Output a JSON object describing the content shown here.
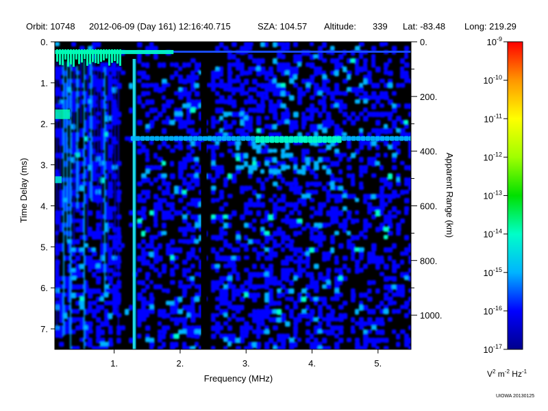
{
  "header": {
    "orbit": "Orbit: 10748",
    "date": "2012-06-09 (Day 161) 12:16:40.715",
    "sza": "SZA: 104.57",
    "altitude_label": "Altitude:",
    "altitude_value": "339",
    "lat": "Lat: -83.48",
    "long": "Long: 219.29"
  },
  "chart_data": {
    "type": "heatmap",
    "xlabel": "Frequency (MHz)",
    "ylabel": "Time Delay (ms)",
    "y2label": "Apparent Range (km)",
    "xlim": [
      0.1,
      5.5
    ],
    "ylim": [
      0,
      7.5
    ],
    "y_inverted": true,
    "x_ticks": [
      1,
      2,
      3,
      4,
      5
    ],
    "x_tick_labels": [
      "1.",
      "2.",
      "3.",
      "4.",
      "5."
    ],
    "y_ticks": [
      0,
      1,
      2,
      3,
      4,
      5,
      6,
      7
    ],
    "y_tick_labels": [
      "0.",
      "1.",
      "2.",
      "3.",
      "4.",
      "5.",
      "6.",
      "7."
    ],
    "y2_range_km": [
      0,
      1125
    ],
    "y2_ticks": [
      0,
      200,
      400,
      600,
      800,
      1000
    ],
    "y2_tick_labels": [
      "0.",
      "200.",
      "400.",
      "600.",
      "800.",
      "1000."
    ],
    "colorbar": {
      "scale": "log",
      "range": [
        -17,
        -9
      ],
      "ticks": [
        -9,
        -10,
        -11,
        -12,
        -13,
        -14,
        -15,
        -16,
        -17
      ],
      "tick_labels": [
        "10",
        "10",
        "10",
        "10",
        "10",
        "10",
        "10",
        "10",
        "10"
      ],
      "tick_exponents": [
        "-9",
        "-10",
        "-11",
        "-12",
        "-13",
        "-14",
        "-15",
        "-16",
        "-17"
      ],
      "colors": [
        "#00008c",
        "#0000ff",
        "#00b4ff",
        "#00ffc8",
        "#00e000",
        "#a0ff00",
        "#ffff00",
        "#ff9600",
        "#ff0000"
      ],
      "unit": {
        "base1": "V",
        "exp1": "2",
        "base2": " m",
        "exp2": "-2",
        "base3": " Hz",
        "exp3": "-1"
      }
    },
    "features": {
      "top_trace_delay_ms": 0.25,
      "bright_echo_delay_ms": 2.35,
      "vertical_band_freq_mhz": 1.3,
      "dark_gap_freq_mhz": 2.38
    }
  },
  "credit": "UIOWA 20130125"
}
